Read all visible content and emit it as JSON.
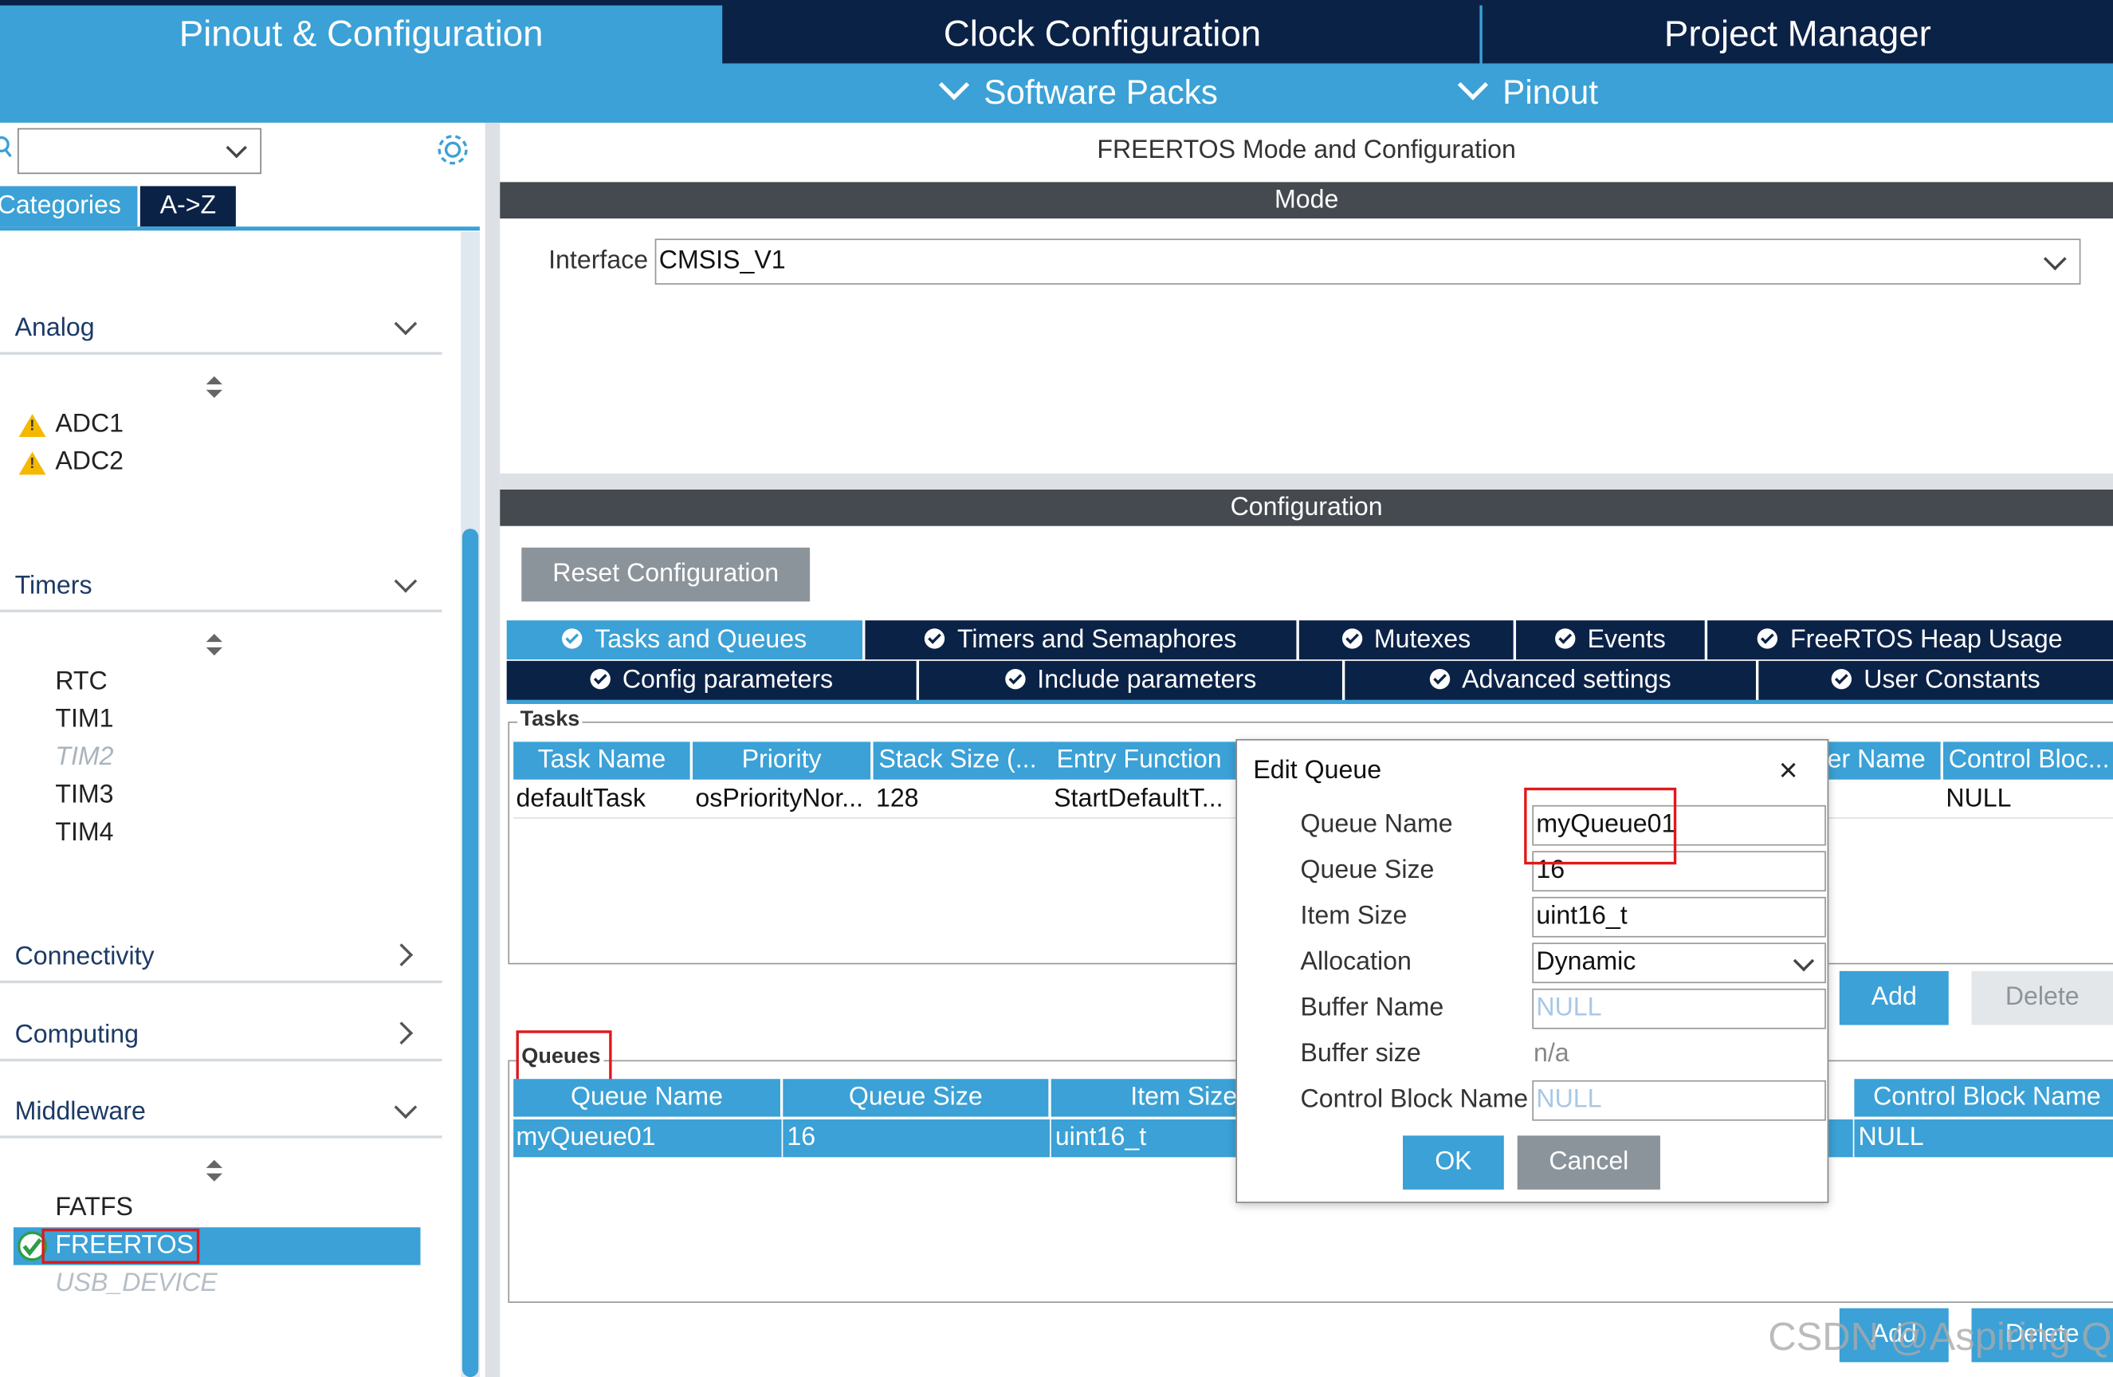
{
  "top_tabs": {
    "pinout": "Pinout & Configuration",
    "clock": "Clock Configuration",
    "project": "Project Manager"
  },
  "sub_nav": {
    "software_packs": "Software Packs",
    "pinout": "Pinout"
  },
  "sidebar": {
    "search_value": "",
    "tabs": {
      "categories": "Categories",
      "az": "A->Z"
    },
    "groups": {
      "analog": {
        "label": "Analog",
        "items": [
          "ADC1",
          "ADC2"
        ]
      },
      "timers": {
        "label": "Timers",
        "items": [
          "RTC",
          "TIM1",
          "TIM2",
          "TIM3",
          "TIM4"
        ]
      },
      "connectivity": {
        "label": "Connectivity"
      },
      "computing": {
        "label": "Computing"
      },
      "middleware": {
        "label": "Middleware",
        "items": [
          "FATFS",
          "FREERTOS",
          "USB_DEVICE"
        ]
      }
    }
  },
  "main": {
    "title": "FREERTOS Mode and Configuration",
    "mode_header": "Mode",
    "interface_label": "Interface",
    "interface_value": "CMSIS_V1",
    "config_header": "Configuration",
    "reset_button": "Reset Configuration",
    "tabs_row1": [
      "Tasks and Queues",
      "Timers and Semaphores",
      "Mutexes",
      "Events",
      "FreeRTOS Heap Usage"
    ],
    "tabs_row2": [
      "Config parameters",
      "Include parameters",
      "Advanced settings",
      "User Constants"
    ],
    "tasks": {
      "legend": "Tasks",
      "columns": [
        "Task Name",
        "Priority",
        "Stack Size (...",
        "Entry Function",
        "er Name",
        "Control Bloc..."
      ],
      "row": [
        "defaultTask",
        "osPriorityNor...",
        "128",
        "StartDefaultT...",
        "",
        "NULL"
      ],
      "add": "Add",
      "delete": "Delete"
    },
    "queues": {
      "legend": "Queues",
      "columns": [
        "Queue Name",
        "Queue Size",
        "Item Size",
        "Control Block Name"
      ],
      "row": [
        "myQueue01",
        "16",
        "uint16_t",
        "NULL"
      ],
      "add": "Add",
      "delete": "Delete"
    }
  },
  "dialog": {
    "title": "Edit Queue",
    "fields": {
      "queue_name": {
        "label": "Queue Name",
        "value": "myQueue01"
      },
      "queue_size": {
        "label": "Queue Size",
        "value": "16"
      },
      "item_size": {
        "label": "Item Size",
        "value": "uint16_t"
      },
      "allocation": {
        "label": "Allocation",
        "value": "Dynamic"
      },
      "buffer_name": {
        "label": "Buffer Name",
        "placeholder": "NULL"
      },
      "buffer_size": {
        "label": "Buffer size",
        "value": "n/a"
      },
      "control_block_name": {
        "label": "Control Block Name",
        "placeholder": "NULL"
      }
    },
    "ok": "OK",
    "cancel": "Cancel"
  },
  "watermark": "CSDN @Aspiring Q",
  "colors": {
    "navy": "#0b2247",
    "accent": "#3ba1d6",
    "highlight_red": "#e0181b",
    "gray_button": "#8c949b"
  }
}
